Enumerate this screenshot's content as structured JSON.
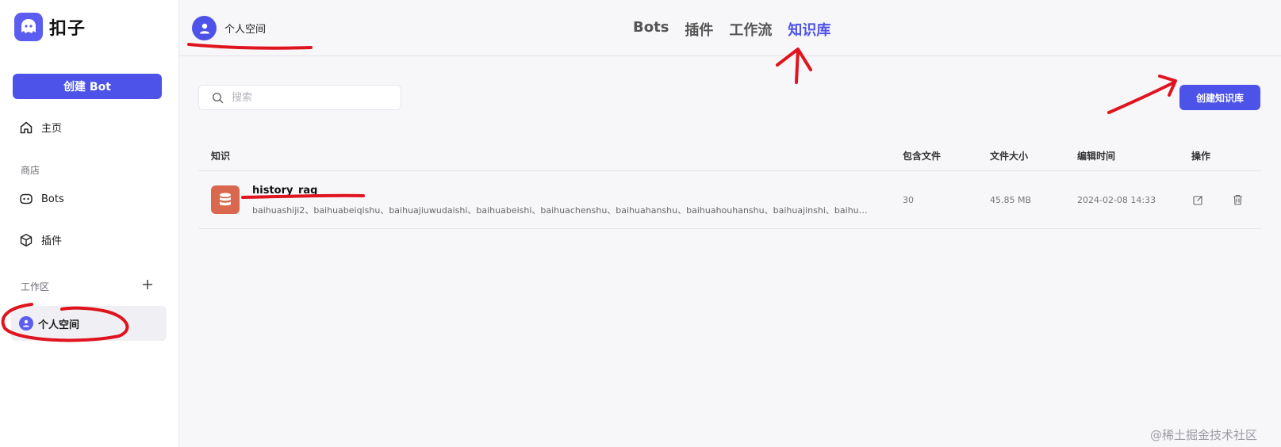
{
  "sidebar": {
    "brand_name": "扣子",
    "create_bot_label": "创建 Bot",
    "home_label": "主页",
    "store_label": "商店",
    "bots_label": "Bots",
    "plugins_label": "插件",
    "workspace_label": "工作区",
    "workspace_item_label": "个人空间"
  },
  "header": {
    "space_name": "个人空间",
    "tabs": [
      {
        "label": "Bots"
      },
      {
        "label": "插件"
      },
      {
        "label": "工作流"
      },
      {
        "label": "知识库"
      }
    ],
    "active_tab": "知识库"
  },
  "main": {
    "search_placeholder": "搜索",
    "create_kb_label": "创建知识库",
    "columns": {
      "knowledge": "知识",
      "files": "包含文件",
      "size": "文件大小",
      "edited": "编辑时间",
      "actions": "操作"
    },
    "rows": [
      {
        "name": "history_rag",
        "description": "baihuashiji2、baihuabeiqishu、baihuajiuwudaishi、baihuabeishi、baihuachenshu、baihuahanshu、baihuahouhanshu、baihuajinshi、baihuasong...",
        "files": "30",
        "size": "45.85 MB",
        "edited": "2024-02-08 14:33"
      }
    ]
  },
  "watermark": "@稀土掘金技术社区",
  "colors": {
    "accent": "#4d53e8",
    "kb_icon": "#d9684e",
    "annotation": "#e0141e"
  }
}
